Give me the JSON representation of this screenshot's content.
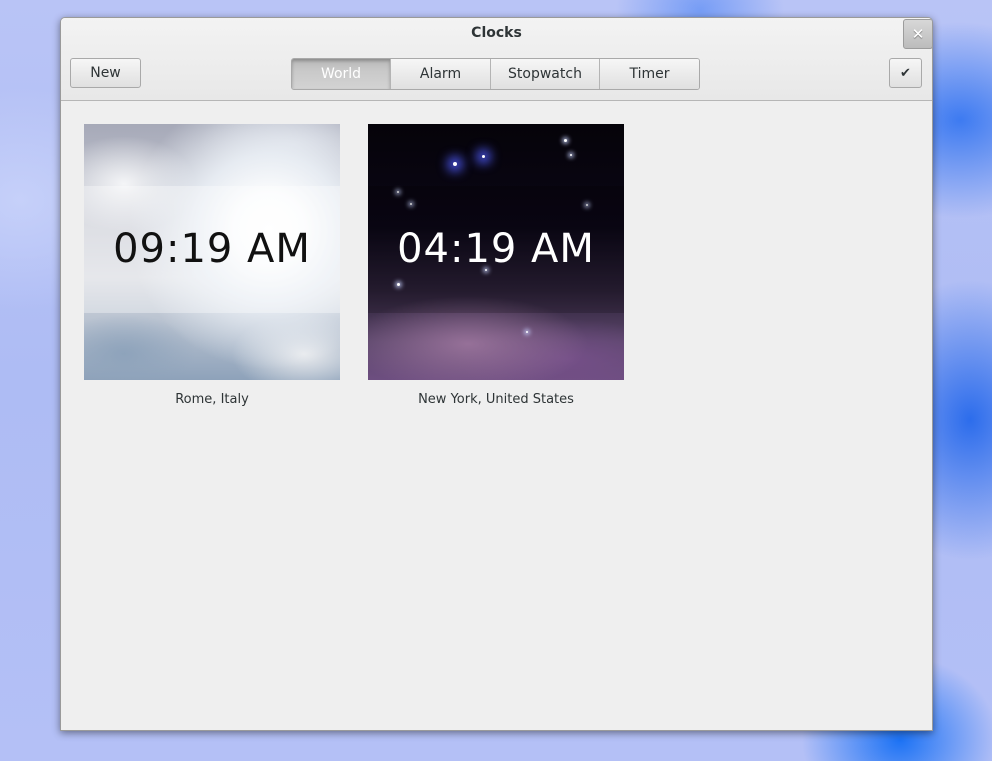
{
  "window": {
    "title": "Clocks",
    "close_icon": "✕"
  },
  "header": {
    "new_label": "New",
    "done_icon": "✔",
    "tabs": [
      {
        "label": "World",
        "active": true
      },
      {
        "label": "Alarm",
        "active": false
      },
      {
        "label": "Stopwatch",
        "active": false
      },
      {
        "label": "Timer",
        "active": false
      }
    ]
  },
  "clocks": [
    {
      "time": "09:19 AM",
      "location": "Rome, Italy",
      "scene": "day"
    },
    {
      "time": "04:19 AM",
      "location": "New York, United States",
      "scene": "night"
    }
  ],
  "colors": {
    "desktop_accent": "#286ef0",
    "window_bg": "#ededed",
    "text": "#2e3436"
  }
}
